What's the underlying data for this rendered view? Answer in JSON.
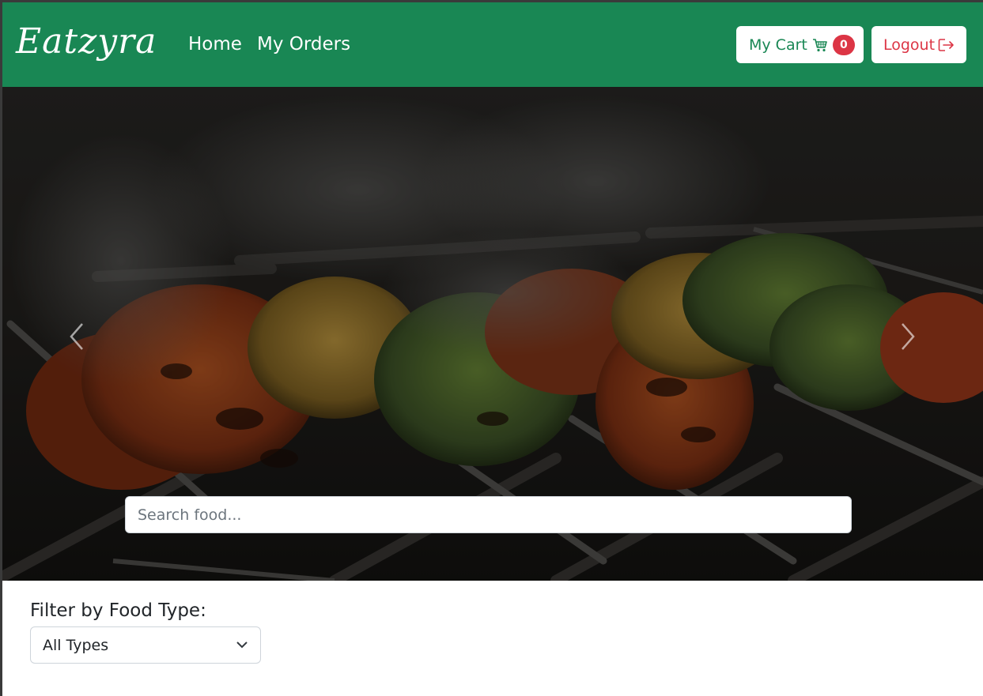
{
  "navbar": {
    "brand": "Eatzyra",
    "links": [
      {
        "label": "Home"
      },
      {
        "label": "My Orders"
      }
    ],
    "cart": {
      "label": "My Cart",
      "count": "0",
      "icon": "cart-icon"
    },
    "logout": {
      "label": "Logout",
      "icon": "logout-icon"
    }
  },
  "hero": {
    "prev_icon": "chevron-left-icon",
    "next_icon": "chevron-right-icon",
    "search": {
      "placeholder": "Search food..."
    }
  },
  "filter": {
    "label": "Filter by Food Type:",
    "selected": "All Types"
  },
  "colors": {
    "navbar": "#198754",
    "badge": "#dc3545",
    "logout": "#dc3545"
  }
}
